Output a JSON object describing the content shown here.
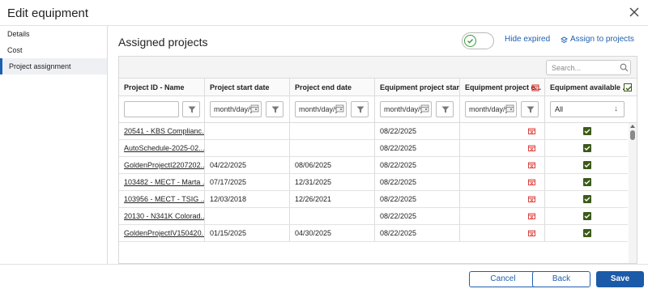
{
  "dialog": {
    "title": "Edit equipment"
  },
  "sidebar": {
    "items": [
      {
        "label": "Details",
        "active": false
      },
      {
        "label": "Cost",
        "active": false
      },
      {
        "label": "Project assignment",
        "active": true
      }
    ]
  },
  "main": {
    "title": "Assigned projects",
    "hide_expired_label": "Hide expired",
    "assign_label": "Assign to projects",
    "toggle_on": false
  },
  "grid": {
    "search_placeholder": "Search...",
    "columns": [
      "Project ID - Name",
      "Project start date",
      "Project end date",
      "Equipment project start ...",
      "Equipment project e...",
      "Equipment available ..."
    ],
    "filters": {
      "date_placeholder": "month/day/year",
      "available_value": "All"
    },
    "rows": [
      {
        "project": "20541 - KBS Complianc...",
        "start": "",
        "end": "",
        "equip_start": "08/22/2025",
        "available": true
      },
      {
        "project": "AutoSchedule-2025-02...",
        "start": "",
        "end": "",
        "equip_start": "08/22/2025",
        "available": true
      },
      {
        "project": "GoldenProjectI2207202...",
        "start": "04/22/2025",
        "end": "08/06/2025",
        "equip_start": "08/22/2025",
        "available": true
      },
      {
        "project": "103482 - MECT - Marta ...",
        "start": "07/17/2025",
        "end": "12/31/2025",
        "equip_start": "08/22/2025",
        "available": true
      },
      {
        "project": "103956 - MECT - TSIG ...",
        "start": "12/03/2018",
        "end": "12/26/2021",
        "equip_start": "08/22/2025",
        "available": true
      },
      {
        "project": "20130 - N341K Colorad...",
        "start": "",
        "end": "",
        "equip_start": "08/22/2025",
        "available": true
      },
      {
        "project": "GoldenProjectIV150420...",
        "start": "01/15/2025",
        "end": "04/30/2025",
        "equip_start": "08/22/2025",
        "available": true
      }
    ]
  },
  "footer": {
    "cancel": "Cancel",
    "back": "Back",
    "save": "Save"
  },
  "colors": {
    "accent": "#1f5faf",
    "primary_button": "#1a5aa8",
    "checkbox": "#3b5a1a",
    "expired_icon": "#d9302c",
    "toggle_check": "#3a9a3a"
  }
}
